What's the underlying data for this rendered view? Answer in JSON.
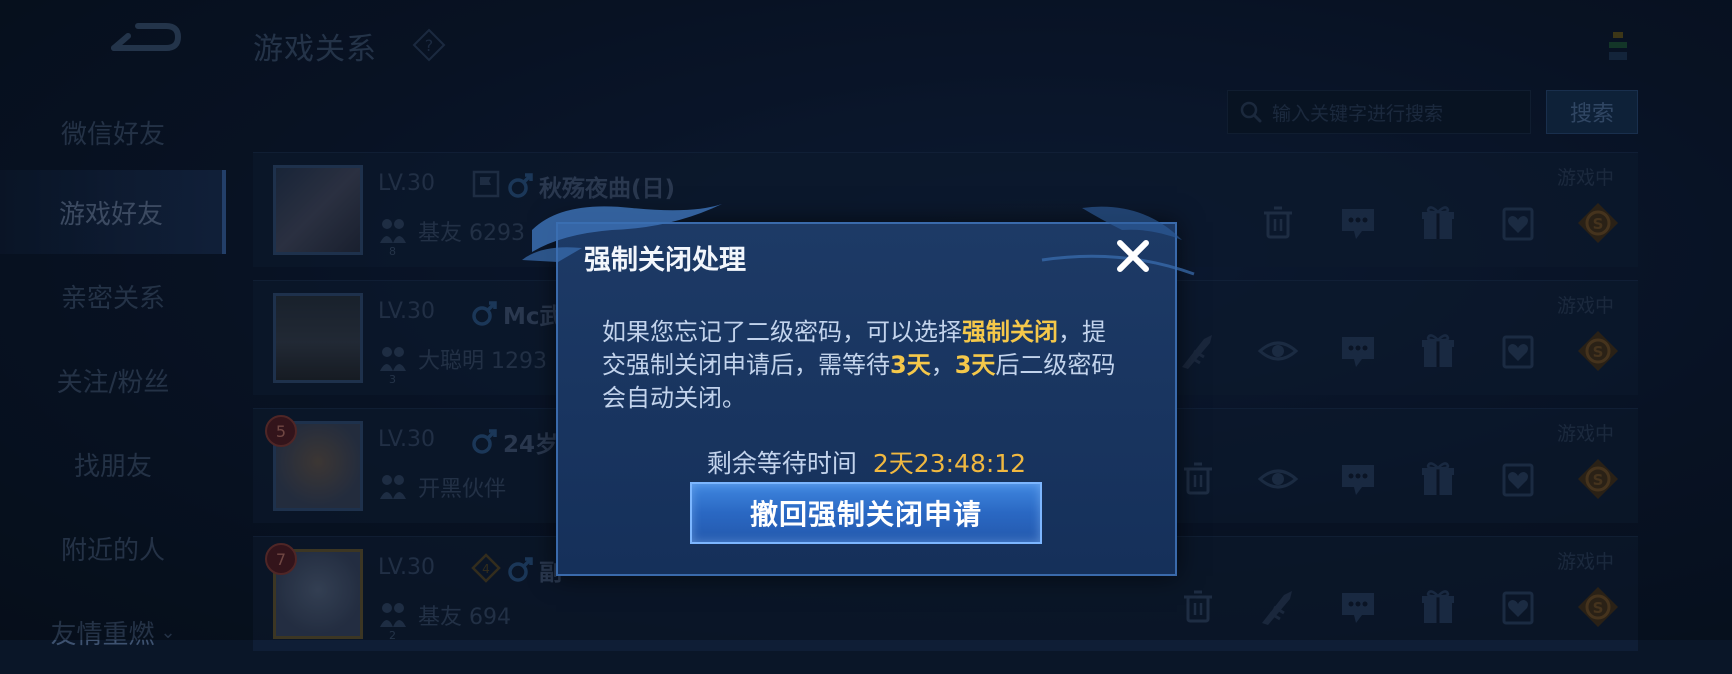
{
  "header": {
    "title": "游戏关系"
  },
  "sidebar": {
    "items": [
      {
        "label": "微信好友"
      },
      {
        "label": "游戏好友"
      },
      {
        "label": "亲密关系"
      },
      {
        "label": "关注/粉丝"
      },
      {
        "label": "找朋友"
      },
      {
        "label": "附近的人"
      },
      {
        "label": "友情重燃"
      }
    ],
    "active_index": 1
  },
  "search": {
    "placeholder": "输入关键字进行搜索",
    "button_label": "搜索"
  },
  "friends": [
    {
      "level": "LV.30",
      "name": "秋殇夜曲(日)",
      "relation": "基友 6293",
      "relation_level": "8",
      "status": "游戏中"
    },
    {
      "level": "LV.30",
      "name": "Mc武",
      "relation": "大聪明 1293",
      "relation_level": "3",
      "status": "游戏中"
    },
    {
      "level": "LV.30",
      "name": "24岁",
      "relation": "开黑伙伴",
      "rank_badge": "5",
      "status": "游戏中"
    },
    {
      "level": "LV.30",
      "name": "副",
      "relation": "基友 694",
      "relation_level": "2",
      "rank_badge": "7",
      "status": "游戏中"
    }
  ],
  "dialog": {
    "title": "强制关闭处理",
    "body_1": "如果您忘记了二级密码，可以选择",
    "body_hl_1": "强制关闭",
    "body_2": "，提交强制关闭申请后，需等待",
    "body_hl_2": "3天",
    "body_3": "，",
    "body_hl_3": "3天",
    "body_4": "后二级密码会自动关闭。",
    "timer_label": "剩余等待时间",
    "timer_value": "2天23:48:12",
    "revoke_button": "撤回强制关闭申请"
  },
  "colors": {
    "highlight": "#f5c84a",
    "timer": "#f0b840",
    "dialog_bg": "#1a3662",
    "button": "#3478d4"
  }
}
